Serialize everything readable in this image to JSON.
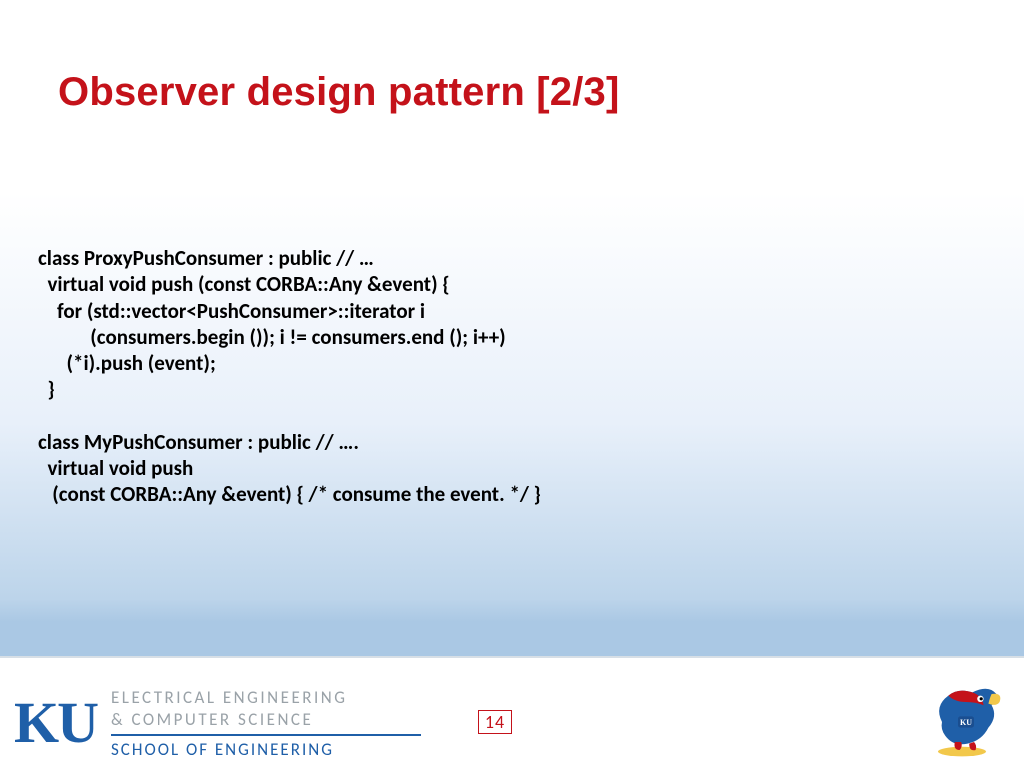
{
  "title": "Observer design pattern [2/3]",
  "code": "class ProxyPushConsumer : public // …\n  virtual void push (const CORBA::Any &event) {\n    for (std::vector<PushConsumer>::iterator i\n           (consumers.begin ()); i != consumers.end (); i++)\n      (*i).push (event);\n  }\n\nclass MyPushConsumer : public // ….\n  virtual void push\n   (const CORBA::Any &event) { /* consume the event. */ }",
  "page_number": "14",
  "footer": {
    "ku": "KU",
    "dept_line1": "ELECTRICAL ENGINEERING",
    "dept_line2": "& COMPUTER SCIENCE",
    "school": "SCHOOL OF ENGINEERING"
  }
}
